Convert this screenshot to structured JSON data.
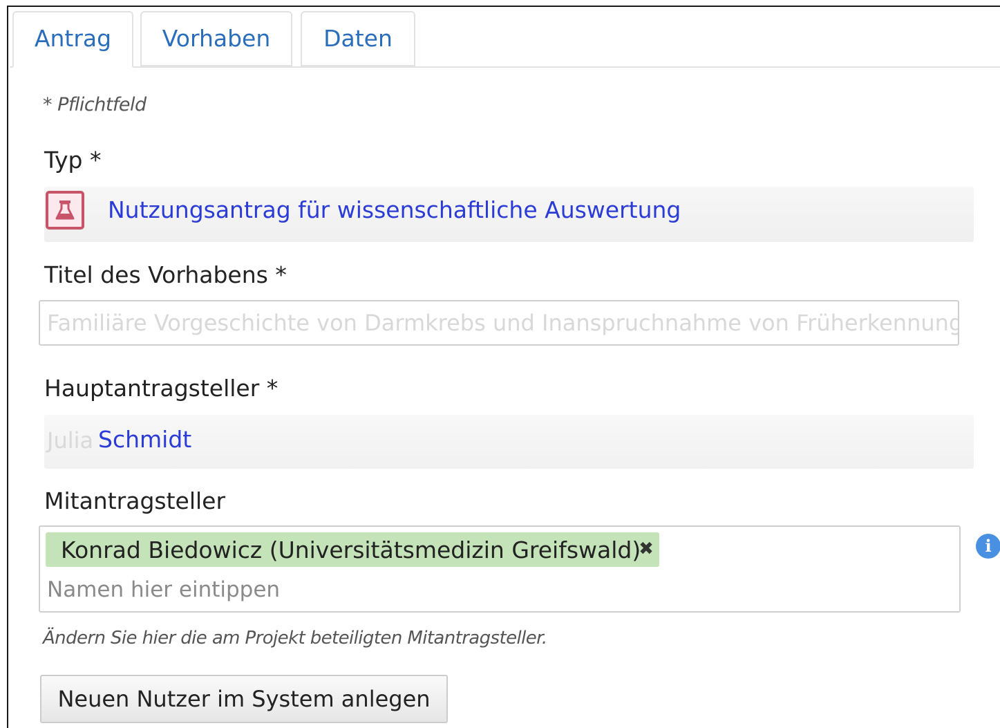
{
  "tabs": [
    {
      "label": "Antrag",
      "active": true
    },
    {
      "label": "Vorhaben",
      "active": false
    },
    {
      "label": "Daten",
      "active": false
    }
  ],
  "form": {
    "required_note": "* Pflichtfeld",
    "typ": {
      "label": "Typ *",
      "value": "Nutzungsantrag für wissenschaftliche Auswertung",
      "icon": "flask-icon",
      "icon_color": "#c8546a"
    },
    "titel": {
      "label": "Titel des Vorhabens *",
      "value": "Familiäre Vorgeschichte von Darmkrebs und Inanspruchnahme von Früherkennung"
    },
    "hauptantragsteller": {
      "label": "Hauptantragsteller *",
      "first_name": "Julia",
      "last_name": "Schmidt"
    },
    "mitantragsteller": {
      "label": "Mitantragsteller",
      "selected": [
        "Konrad Biedowicz (Universitätsmedizin Greifswald)"
      ],
      "remove_symbol": "✖",
      "placeholder": "Namen hier eintippen",
      "help_text": "Ändern Sie hier die am Projekt beteiligten Mitantragsteller.",
      "chip_color": "#c4e3b8"
    },
    "new_user_button": "Neuen Nutzer im System anlegen"
  },
  "colors": {
    "tab_text": "#2a6ebb",
    "link": "#2a3bd6",
    "info": "#4a90e2"
  }
}
